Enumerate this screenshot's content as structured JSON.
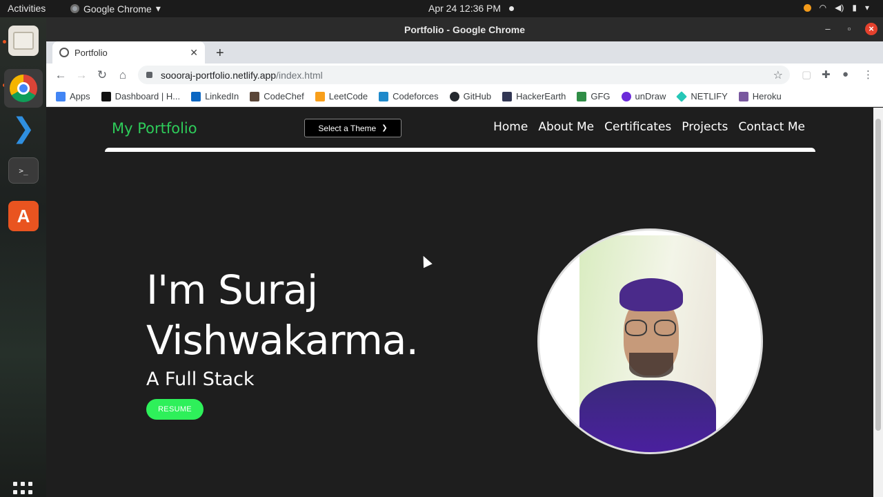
{
  "system": {
    "activities": "Activities",
    "app_name": "Google Chrome",
    "clock": "Apr 24  12:36 PM"
  },
  "window": {
    "title": "Portfolio - Google Chrome"
  },
  "tab": {
    "title": "Portfolio"
  },
  "address": {
    "host": "soooraj-portfolio.netlify.app",
    "path": "/index.html"
  },
  "bookmarks": [
    {
      "label": "Apps",
      "color": "#4285f4"
    },
    {
      "label": "Dashboard | H...",
      "color": "#111111"
    },
    {
      "label": "LinkedIn",
      "color": "#0a66c2"
    },
    {
      "label": "CodeChef",
      "color": "#5b4638"
    },
    {
      "label": "LeetCode",
      "color": "#f89f1b"
    },
    {
      "label": "Codeforces",
      "color": "#1f8acb"
    },
    {
      "label": "GitHub",
      "color": "#24292e"
    },
    {
      "label": "HackerEarth",
      "color": "#323754"
    },
    {
      "label": "GFG",
      "color": "#2f8d46"
    },
    {
      "label": "unDraw",
      "color": "#6c2bd9"
    },
    {
      "label": "NETLIFY",
      "color": "#25c7b7"
    },
    {
      "label": "Heroku",
      "color": "#79589f"
    }
  ],
  "page": {
    "brand": "My Portfolio",
    "theme_select": "Select a Theme",
    "menu": [
      "Home",
      "About Me",
      "Certificates",
      "Projects",
      "Contact Me"
    ],
    "hero_line1": "I'm Suraj",
    "hero_line2": "Vishwakarma.",
    "subtitle": "A Full Stack",
    "resume": "RESUME",
    "accent": "#2ecc5a"
  }
}
